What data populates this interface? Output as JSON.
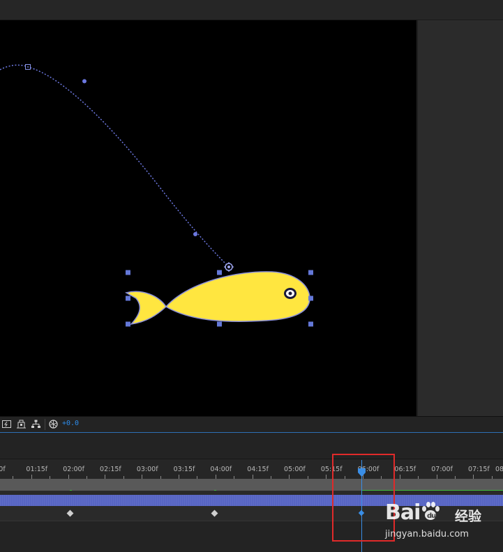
{
  "viewer": {
    "background": "#000000",
    "shape_fill": "#FFE640",
    "shape_stroke": "#8a8fd8",
    "path_color": "#6c78e0",
    "handle_color": "#6478d8"
  },
  "toolbar": {
    "icons": [
      "fast-preview-icon",
      "transparency-grid-icon",
      "comp-flowchart-icon",
      "reset-exposure-icon"
    ],
    "exposure": "+0.0"
  },
  "timeline": {
    "ruler_labels": [
      "0f",
      "01:15f",
      "02:00f",
      "02:15f",
      "03:00f",
      "03:15f",
      "04:00f",
      "04:15f",
      "05:00f",
      "05:15f",
      "06:00f",
      "06:15f",
      "07:00f",
      "07:15f",
      "08"
    ],
    "layer_bar_color": "#5765c4",
    "playhead_color": "#3a8ee6",
    "keyframe_color": "#cfcfcf",
    "selected_keyframe_color": "#3a8ee6"
  },
  "annotation": {
    "highlight_color": "#e02a2a"
  },
  "watermark": {
    "brand": "Bai",
    "brand_tail": "du",
    "chinese": "经验",
    "url": "jingyan.baidu.com"
  }
}
